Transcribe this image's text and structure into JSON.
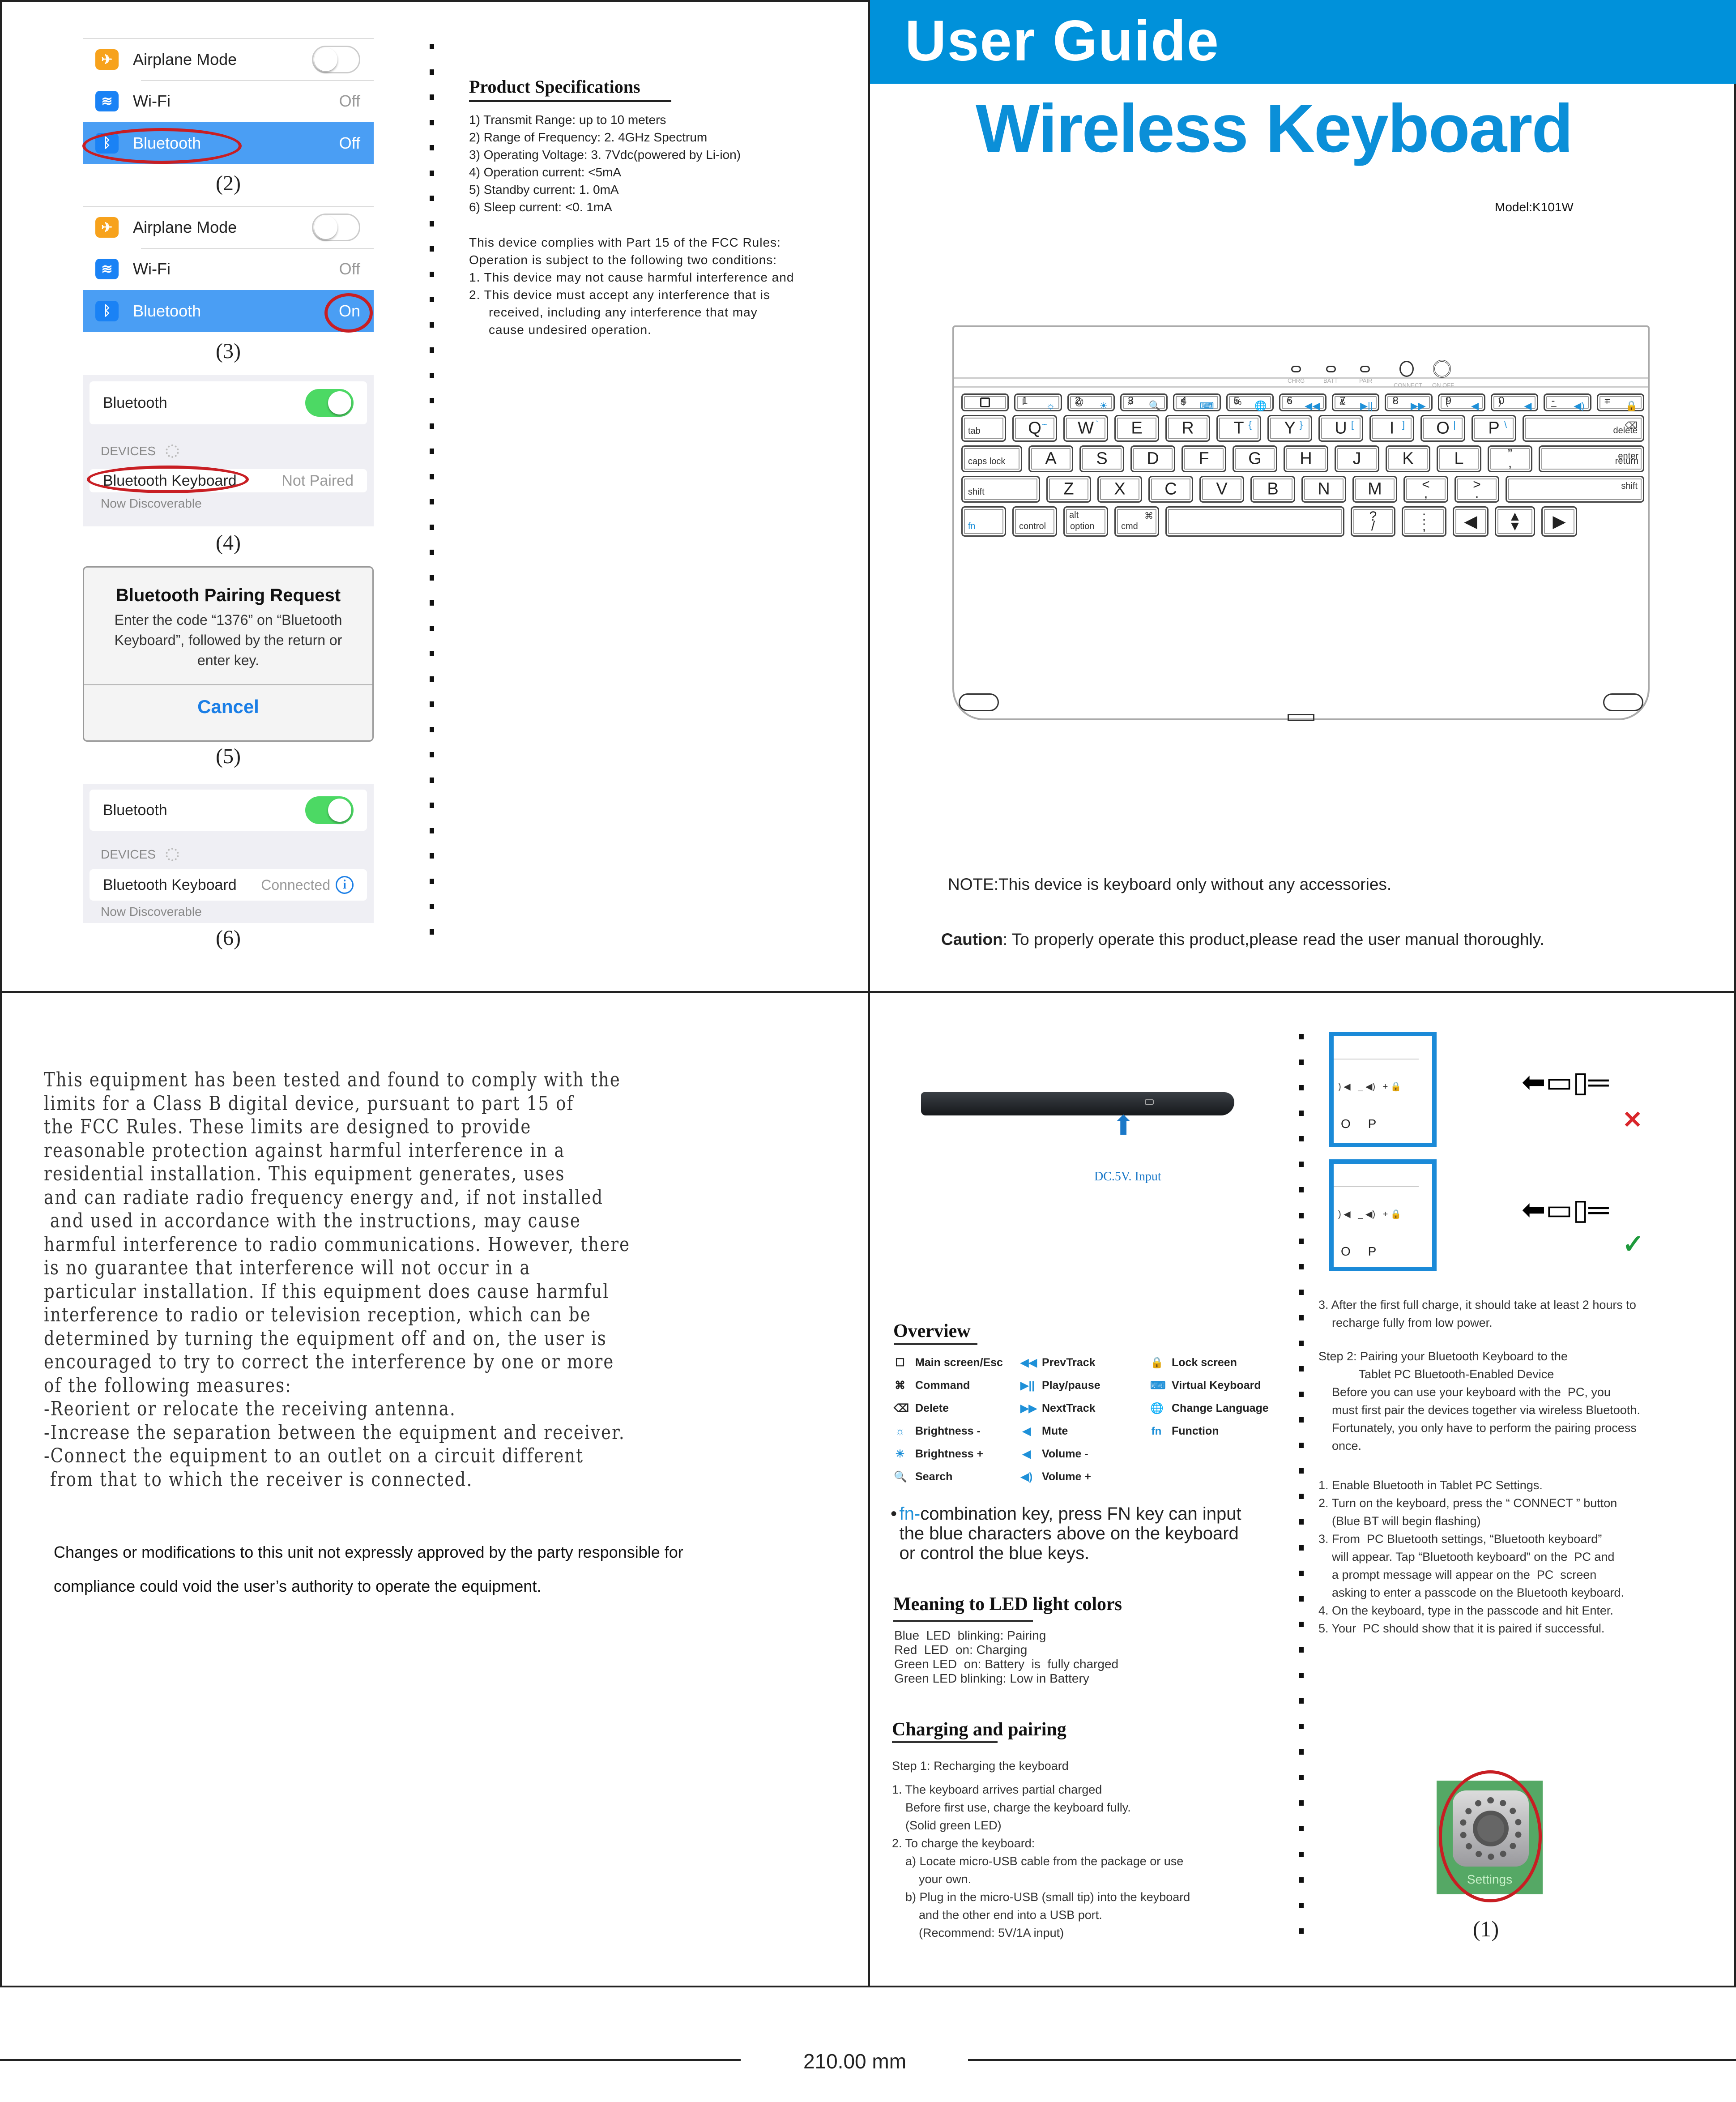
{
  "document": {
    "width_label": "210.00 mm"
  },
  "ios_steps": {
    "step2": {
      "caption": "(2)",
      "rows": [
        {
          "label": "Airplane Mode",
          "value": "",
          "toggle": "off"
        },
        {
          "label": "Wi-Fi",
          "value": "Off"
        },
        {
          "label": "Bluetooth",
          "value": "Off",
          "highlighted": true
        }
      ]
    },
    "step3": {
      "caption": "(3)",
      "rows": [
        {
          "label": "Airplane Mode",
          "value": "",
          "toggle": "off"
        },
        {
          "label": "Wi-Fi",
          "value": "Off"
        },
        {
          "label": "Bluetooth",
          "value": "On",
          "highlighted": true
        }
      ]
    },
    "step4": {
      "caption": "(4)",
      "bluetooth_label": "Bluetooth",
      "devices_label": "DEVICES",
      "device_name": "Bluetooth Keyboard",
      "device_status": "Not Paired",
      "footer": "Now Discoverable"
    },
    "step5": {
      "caption": "(5)",
      "title": "Bluetooth Pairing Request",
      "message": "Enter the code “1376” on “Bluetooth Keyboard”, followed by the return or enter key.",
      "cancel_label": "Cancel"
    },
    "step6": {
      "caption": "(6)",
      "bluetooth_label": "Bluetooth",
      "devices_label": "DEVICES",
      "device_name": "Bluetooth Keyboard",
      "device_status": "Connected",
      "footer": "Now Discoverable"
    },
    "step1": {
      "caption": "(1)",
      "app_label": "Settings"
    }
  },
  "specs": {
    "title": "Product Specifications",
    "items": [
      "1) Transmit Range: up to 10 meters",
      "2) Range of Frequency: 2. 4GHz Spectrum",
      "3) Operating Voltage: 3. 7Vdc(powered by Li-ion)",
      "4) Operation current: <5mA",
      "5) Standby current: 1. 0mA",
      "6) Sleep current: <0. 1mA"
    ],
    "fcc_intro_1": "This device complies with Part 15 of the FCC Rules:",
    "fcc_intro_2": "Operation is subject to the following two conditions:",
    "fcc_cond_1": "1.  This device may not cause harmful interference and",
    "fcc_cond_2a": "2.  This device must accept any interference that is",
    "fcc_cond_2b": "received,  including any interference that may",
    "fcc_cond_2c": "cause undesired operation."
  },
  "cover": {
    "banner": "User Guide",
    "title": "Wireless Keyboard",
    "model": "Model:K101W",
    "note": "NOTE:This device is keyboard only without any accessories.",
    "caution_label": "Caution",
    "caution_text": ": To properly operate this product,please read the user manual thoroughly.",
    "led_labels": [
      "CHRG",
      "BATT",
      "PAIR",
      "CONNECT",
      "ON  OFF"
    ],
    "brand_color": "#0091da"
  },
  "keyboard": {
    "row1": [
      {
        "main": "",
        "glyph": "square"
      },
      {
        "top": "!",
        "bottom": "1",
        "fn": "☼"
      },
      {
        "top": "@",
        "bottom": "2",
        "fn": "☀"
      },
      {
        "top": "#",
        "bottom": "3",
        "fn": "🔍"
      },
      {
        "top": "$",
        "bottom": "4",
        "fn": "⌨"
      },
      {
        "top": "%",
        "bottom": "5",
        "fn": "🌐"
      },
      {
        "top": "^",
        "bottom": "6",
        "fn": "◀◀"
      },
      {
        "top": "&",
        "bottom": "7",
        "fn": "▶||"
      },
      {
        "top": "*",
        "bottom": "8",
        "fn": "▶▶"
      },
      {
        "top": "(",
        "bottom": "9",
        "fn": "◀"
      },
      {
        "top": ")",
        "bottom": "0",
        "fn": "◀"
      },
      {
        "top": "_",
        "bottom": "-",
        "fn": "◀)"
      },
      {
        "top": "+",
        "bottom": "=",
        "fn": "🔒"
      }
    ],
    "row2": [
      {
        "main": "tab",
        "small": true
      },
      {
        "main": "Q",
        "fn": "~"
      },
      {
        "main": "W",
        "fn": "`"
      },
      {
        "main": "E"
      },
      {
        "main": "R"
      },
      {
        "main": "T",
        "fn": "{"
      },
      {
        "main": "Y",
        "fn": "}"
      },
      {
        "main": "U",
        "fn": "["
      },
      {
        "main": "I",
        "fn": "]"
      },
      {
        "main": "O",
        "fn": "|"
      },
      {
        "main": "P",
        "fn": "\\"
      },
      {
        "main": "delete",
        "small": true,
        "glyph": "⌫"
      }
    ],
    "row3": [
      {
        "main": "caps lock",
        "small": true
      },
      {
        "main": "A"
      },
      {
        "main": "S"
      },
      {
        "main": "D"
      },
      {
        "main": "F"
      },
      {
        "main": "G"
      },
      {
        "main": "H"
      },
      {
        "main": "J"
      },
      {
        "main": "K"
      },
      {
        "main": "L"
      },
      {
        "main": "”",
        "sub": ","
      },
      {
        "main": "enter",
        "sub": "return",
        "small": true
      }
    ],
    "row4": [
      {
        "main": "shift",
        "small": true
      },
      {
        "main": "Z"
      },
      {
        "main": "X"
      },
      {
        "main": "C"
      },
      {
        "main": "V"
      },
      {
        "main": "B"
      },
      {
        "main": "N"
      },
      {
        "main": "M"
      },
      {
        "main": "<",
        "sub": ","
      },
      {
        "main": ">",
        "sub": "."
      },
      {
        "main": "shift",
        "small": true
      }
    ],
    "row5": [
      {
        "main": "fn",
        "small": true,
        "blue": true
      },
      {
        "main": "control",
        "small": true
      },
      {
        "main": "option",
        "top": "alt",
        "small": true
      },
      {
        "main": "cmd",
        "top": "⌘",
        "small": true
      },
      {
        "main": ""
      },
      {
        "main": "?",
        "sub": "/"
      },
      {
        "main": ":",
        "sub": ";"
      },
      {
        "main": "◀"
      },
      {
        "main": "▲",
        "sub": "▼"
      },
      {
        "main": "▶"
      }
    ]
  },
  "fcc_statement": {
    "lines": [
      "This equipment has been tested and found to comply with the",
      "limits for a Class B digital device, pursuant to part 15 of",
      "the FCC Rules. These limits are designed to provide",
      "reasonable protection against harmful interference in a",
      "residential installation. This equipment generates, uses",
      "and can radiate radio frequency energy and, if not installed",
      " and used in accordance with the instructions, may cause",
      "harmful interference to radio communications. However, there",
      "is no guarantee that interference will not occur in a",
      "particular installation. If this equipment does cause harmful",
      "interference to radio or television reception, which can be",
      "determined by turning the equipment off and on, the user is",
      "encouraged to try to correct the interference by one or more",
      "of the following measures:",
      "-Reorient or relocate the receiving antenna.",
      "-Increase the separation between the equipment and receiver.",
      "-Connect the equipment to an outlet on a circuit different",
      " from that to which the receiver is connected."
    ],
    "changes_1": "Changes or modifications to this unit not expressly approved by the party responsible for",
    "changes_2": "compliance could void the user’s authority to operate the equipment."
  },
  "charging_figure": {
    "dc_label": "DC.5V. Input",
    "wrong_mark": "✕",
    "right_mark": "✓",
    "wrong_color": "#d9262b",
    "right_color": "#1e9a3c"
  },
  "overview": {
    "title": "Overview",
    "col1": [
      {
        "icon": "☐",
        "label": "Main screen/Esc"
      },
      {
        "icon": "⌘",
        "label": "Command"
      },
      {
        "icon": "⌫",
        "label": "Delete"
      },
      {
        "icon": "☼",
        "label": "Brightness -"
      },
      {
        "icon": "☀",
        "label": "Brightness +"
      },
      {
        "icon": "🔍",
        "label": "Search"
      }
    ],
    "col2": [
      {
        "icon": "◀◀",
        "label": "PrevTrack"
      },
      {
        "icon": "▶||",
        "label": "Play/pause"
      },
      {
        "icon": "▶▶",
        "label": "NextTrack"
      },
      {
        "icon": "◀",
        "label": "Mute"
      },
      {
        "icon": "◀",
        "label": "Volume -"
      },
      {
        "icon": "◀)",
        "label": "Volume +"
      }
    ],
    "col3": [
      {
        "icon": "🔒",
        "label": "Lock screen"
      },
      {
        "icon": "⌨",
        "label": "Virtual Keyboard"
      },
      {
        "icon": "🌐",
        "label": "Change Language"
      },
      {
        "icon": "fn",
        "label": "Function"
      }
    ],
    "fn_prefix": "fn-",
    "fn_note": "combination key, press FN key can input the blue characters above on the keyboard or control the blue keys."
  },
  "led_meaning": {
    "title": "Meaning to LED light colors",
    "lines": [
      "Blue  LED  blinking: Pairing",
      "Red  LED  on: Charging",
      "Green LED  on: Battery  is  fully charged",
      "Green LED blinking: Low in Battery"
    ]
  },
  "charging": {
    "title": "Charging and pairing",
    "step1": "Step 1: Recharging the keyboard",
    "lines": [
      "1. The keyboard arrives partial charged",
      "    Before first use, charge the keyboard fully.",
      "    (Solid green LED)",
      "2. To charge the keyboard:",
      "    a) Locate micro-USB cable from the package or use",
      "        your own.",
      "    b) Plug in the micro-USB (small tip) into the keyboard",
      "        and the other end into a USB port.",
      "        (Recommend: 5V/1A input)"
    ]
  },
  "pairing": {
    "after_charge": [
      "3. After the first full charge, it should take at least 2 hours to",
      "    recharge fully from low power."
    ],
    "step2": [
      "Step 2: Pairing your Bluetooth Keyboard to the",
      "            Tablet PC Bluetooth-Enabled Device",
      "    Before you can use your keyboard with the  PC, you",
      "    must first pair the devices together via wireless Bluetooth.",
      "    Fortunately, you only have to perform the pairing process",
      "    once."
    ],
    "steps": [
      "1. Enable Bluetooth in Tablet PC Settings.",
      "2. Turn on the keyboard, press the “ CONNECT ” button",
      "    (Blue BT will begin flashing)",
      "3. From  PC Bluetooth settings, “Bluetooth keyboard”",
      "    will appear. Tap “Bluetooth keyboard” on the  PC and",
      "    a prompt message will appear on the  PC  screen",
      "    asking to enter a passcode on the Bluetooth keyboard.",
      "4. On the keyboard, type in the passcode and hit Enter.",
      "5. Your  PC should show that it is paired if successful."
    ]
  }
}
